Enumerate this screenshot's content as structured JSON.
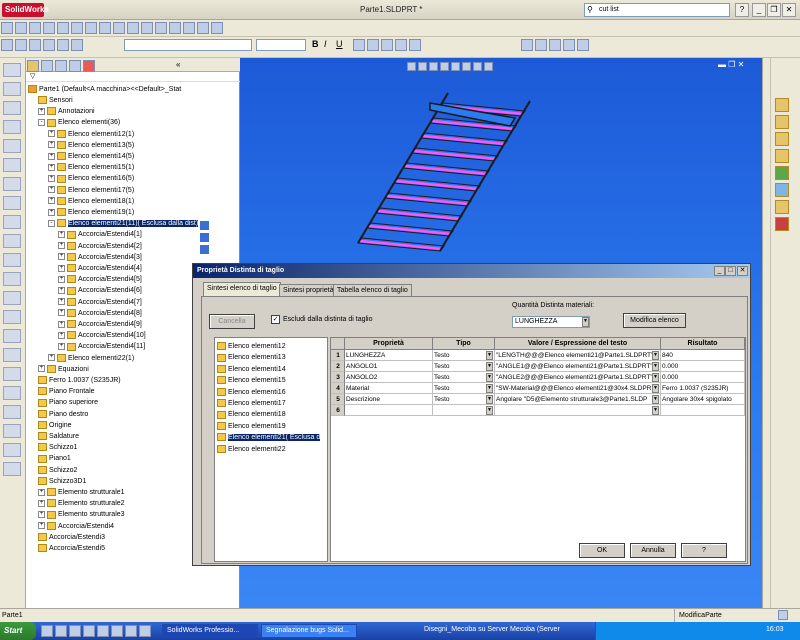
{
  "app": {
    "logo": "SolidWorks",
    "title": "Parte1.SLDPRT *",
    "search_value": "cut list"
  },
  "tree": {
    "root": "Parte1  (Default<A macchina><<Default>_Stat",
    "items": [
      {
        "label": "Sensori",
        "indent": 1
      },
      {
        "label": "Annotazioni",
        "indent": 1,
        "pm": "+"
      },
      {
        "label": "Elenco elementi(36)",
        "indent": 1,
        "pm": "-"
      },
      {
        "label": "Elenco elementi12(1)",
        "indent": 2,
        "pm": "+"
      },
      {
        "label": "Elenco elementi13(5)",
        "indent": 2,
        "pm": "+"
      },
      {
        "label": "Elenco elementi14(5)",
        "indent": 2,
        "pm": "+"
      },
      {
        "label": "Elenco elementi15(1)",
        "indent": 2,
        "pm": "+"
      },
      {
        "label": "Elenco elementi16(5)",
        "indent": 2,
        "pm": "+"
      },
      {
        "label": "Elenco elementi17(5)",
        "indent": 2,
        "pm": "+"
      },
      {
        "label": "Elenco elementi18(1)",
        "indent": 2,
        "pm": "+"
      },
      {
        "label": "Elenco elementi19(1)",
        "indent": 2,
        "pm": "+"
      },
      {
        "label": "Elenco elementi21(11)( Esclusa dalla dist)",
        "indent": 2,
        "pm": "-",
        "selected": true
      },
      {
        "label": "Accorcia/Estendi4[1]",
        "indent": 3,
        "pm": "+"
      },
      {
        "label": "Accorcia/Estendi4[2]",
        "indent": 3,
        "pm": "+"
      },
      {
        "label": "Accorcia/Estendi4[3]",
        "indent": 3,
        "pm": "+"
      },
      {
        "label": "Accorcia/Estendi4[4]",
        "indent": 3,
        "pm": "+"
      },
      {
        "label": "Accorcia/Estendi4[5]",
        "indent": 3,
        "pm": "+"
      },
      {
        "label": "Accorcia/Estendi4[6]",
        "indent": 3,
        "pm": "+"
      },
      {
        "label": "Accorcia/Estendi4[7]",
        "indent": 3,
        "pm": "+"
      },
      {
        "label": "Accorcia/Estendi4[8]",
        "indent": 3,
        "pm": "+"
      },
      {
        "label": "Accorcia/Estendi4[9]",
        "indent": 3,
        "pm": "+"
      },
      {
        "label": "Accorcia/Estendi4[10]",
        "indent": 3,
        "pm": "+"
      },
      {
        "label": "Accorcia/Estendi4[11]",
        "indent": 3,
        "pm": "+"
      },
      {
        "label": "Elenco elementi22(1)",
        "indent": 2,
        "pm": "+"
      },
      {
        "label": "Equazioni",
        "indent": 1,
        "pm": "+"
      },
      {
        "label": "Ferro 1.0037 (S235JR)",
        "indent": 1
      },
      {
        "label": "Piano Frontale",
        "indent": 1
      },
      {
        "label": "Piano superiore",
        "indent": 1
      },
      {
        "label": "Piano destro",
        "indent": 1
      },
      {
        "label": "Origine",
        "indent": 1
      },
      {
        "label": "Saldature",
        "indent": 1
      },
      {
        "label": "Schizzo1",
        "indent": 1
      },
      {
        "label": "Piano1",
        "indent": 1
      },
      {
        "label": "Schizzo2",
        "indent": 1
      },
      {
        "label": "Schizzo3D1",
        "indent": 1
      },
      {
        "label": "Elemento strutturale1",
        "indent": 1,
        "pm": "+"
      },
      {
        "label": "Elemento strutturale2",
        "indent": 1,
        "pm": "+"
      },
      {
        "label": "Elemento strutturale3",
        "indent": 1,
        "pm": "+"
      },
      {
        "label": "Accorcia/Estendi4",
        "indent": 1,
        "pm": "+"
      },
      {
        "label": "Accorcia/Estendi3",
        "indent": 1
      },
      {
        "label": "Accorcia/Estendi5",
        "indent": 1
      }
    ]
  },
  "dialog": {
    "title": "Proprietà Distinta di taglio",
    "tabs": [
      "Sintesi elenco di taglio",
      "Sintesi proprietà",
      "Tabella elenco di taglio"
    ],
    "cancel_label": "Cancella",
    "exclude_label": "Escludi dalla distinta di taglio",
    "qty_label": "Quantità Distinta materiali:",
    "qty_value": "LUNGHEZZA",
    "modify_label": "Modifica elenco",
    "list": [
      "Elenco elementi12",
      "Elenco elementi13",
      "Elenco elementi14",
      "Elenco elementi15",
      "Elenco elementi16",
      "Elenco elementi17",
      "Elenco elementi18",
      "Elenco elementi19",
      "Elenco elementi21( Esclusa d",
      "Elenco elementi22"
    ],
    "columns": [
      "Proprietà",
      "Tipo",
      "Valore / Espressione del testo",
      "Risultato"
    ],
    "rows": [
      {
        "n": "1",
        "prop": "LUNGHEZZA",
        "tipo": "Testo",
        "val": "\"LENGTH@@@Elenco elementi21@Parte1.SLDPRT\"",
        "res": "840"
      },
      {
        "n": "2",
        "prop": "ANGOLO1",
        "tipo": "Testo",
        "val": "\"ANGLE1@@@Elenco elementi21@Parte1.SLDPRT\"",
        "res": "0.000"
      },
      {
        "n": "3",
        "prop": "ANGOLO2",
        "tipo": "Testo",
        "val": "\"ANGLE2@@@Elenco elementi21@Parte1.SLDPRT\"",
        "res": "0.000"
      },
      {
        "n": "4",
        "prop": "Material",
        "tipo": "Testo",
        "val": "\"SW-Material@@@Elenco elementi21@30x4.SLDPR",
        "res": "Ferro 1.0037 (S235JR)"
      },
      {
        "n": "5",
        "prop": "Descrizione",
        "tipo": "Testo",
        "val": "Angolare \"D5@Elemento strutturale3@Parte1.SLDP",
        "res": "Angolare 30x4 spigolato"
      },
      {
        "n": "6",
        "prop": "",
        "tipo": "",
        "val": "",
        "res": ""
      }
    ],
    "ok_label": "OK",
    "annulla_label": "Annulla",
    "help_label": "?"
  },
  "status": {
    "left": "Parte1",
    "right": "ModificaParte"
  },
  "taskbar": {
    "start": "Start",
    "tasks": [
      "SolidWorks Professio...",
      "Segnalazione bugs Solid...",
      "Disegni_Mecoba su Server Mecoba (Server"
    ],
    "clock": "16:03"
  },
  "colors": {
    "viewport": "#2b7bf0",
    "stair_top": "#ff55ff",
    "stair_edge": "#1a1a1a"
  }
}
